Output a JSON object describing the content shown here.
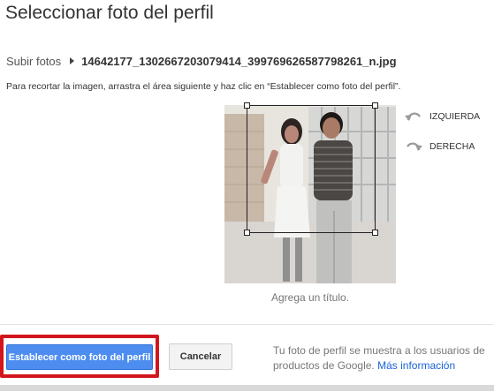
{
  "dialog": {
    "title": "Seleccionar foto del perfil"
  },
  "breadcrumb": {
    "root": "Subir fotos",
    "file": "14642177_1302667203079414_399769626587798261_n.jpg"
  },
  "instruction": "Para recortar la imagen, arrastra el área siguiente y haz clic en “Establecer como foto del perfil”.",
  "rotate": {
    "left_label": "IZQUIERDA",
    "right_label": "DERECHA"
  },
  "caption_placeholder": "Agrega un título.",
  "footer": {
    "primary_label": "Establecer como foto del perfil",
    "cancel_label": "Cancelar",
    "note_text": "Tu foto de perfil se muestra a los usuarios de productos de Google.",
    "more_info_link": "Más información"
  },
  "colors": {
    "primary_button": "#4d8df0",
    "highlight_border": "#d3151c",
    "link": "#1a62d4"
  }
}
